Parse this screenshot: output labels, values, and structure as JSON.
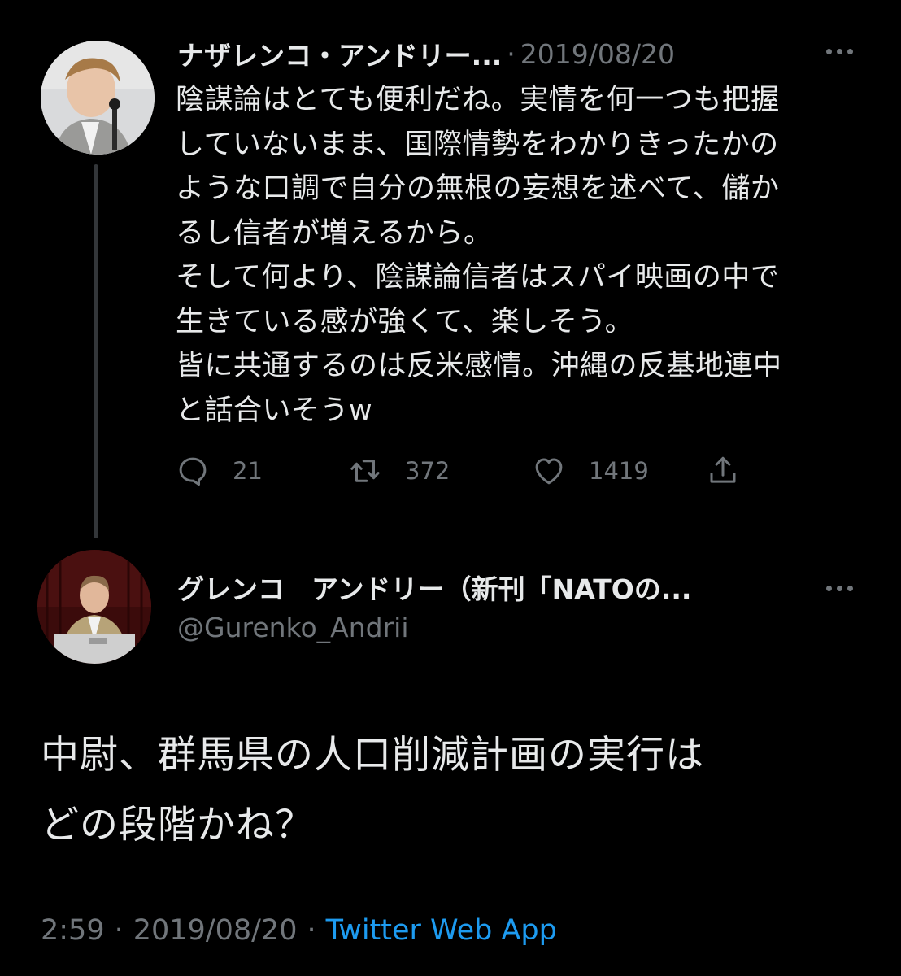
{
  "colors": {
    "background": "#000000",
    "text_primary": "#e7e9ea",
    "text_secondary": "#71767b",
    "link": "#1d9bf0"
  },
  "quoted_tweet": {
    "author_name": "ナザレンコ・アンドリー...",
    "separator": "·",
    "date": "2019/08/20",
    "text": "陰謀論はとても便利だね。実情を何一つも把握\nしていないまま、国際情勢をわかりきったかの\nような口調で自分の無根の妄想を述べて、儲か\nるし信者が増えるから。\nそして何より、陰謀論信者はスパイ映画の中で\n生きている感が強くて、楽しそう。\n皆に共通するのは反米感情。沖縄の反基地連中\nと話合いそうw",
    "reply_count": "21",
    "retweet_count": "372",
    "like_count": "1419",
    "icons": {
      "more": "more-horizontal-icon",
      "reply": "reply-bubble-icon",
      "retweet": "retweet-icon",
      "like": "heart-icon",
      "share": "share-icon"
    }
  },
  "main_tweet": {
    "author_name": "グレンコ　アンドリー（新刊「NATOの...",
    "handle": "@Gurenko_Andrii",
    "text": "中尉、群馬県の人口削減計画の実行は\nどの段階かね？",
    "time": "2:59",
    "separator": "·",
    "date": "2019/08/20",
    "separator2": "·",
    "source": "Twitter Web App",
    "icons": {
      "more": "more-horizontal-icon"
    }
  }
}
